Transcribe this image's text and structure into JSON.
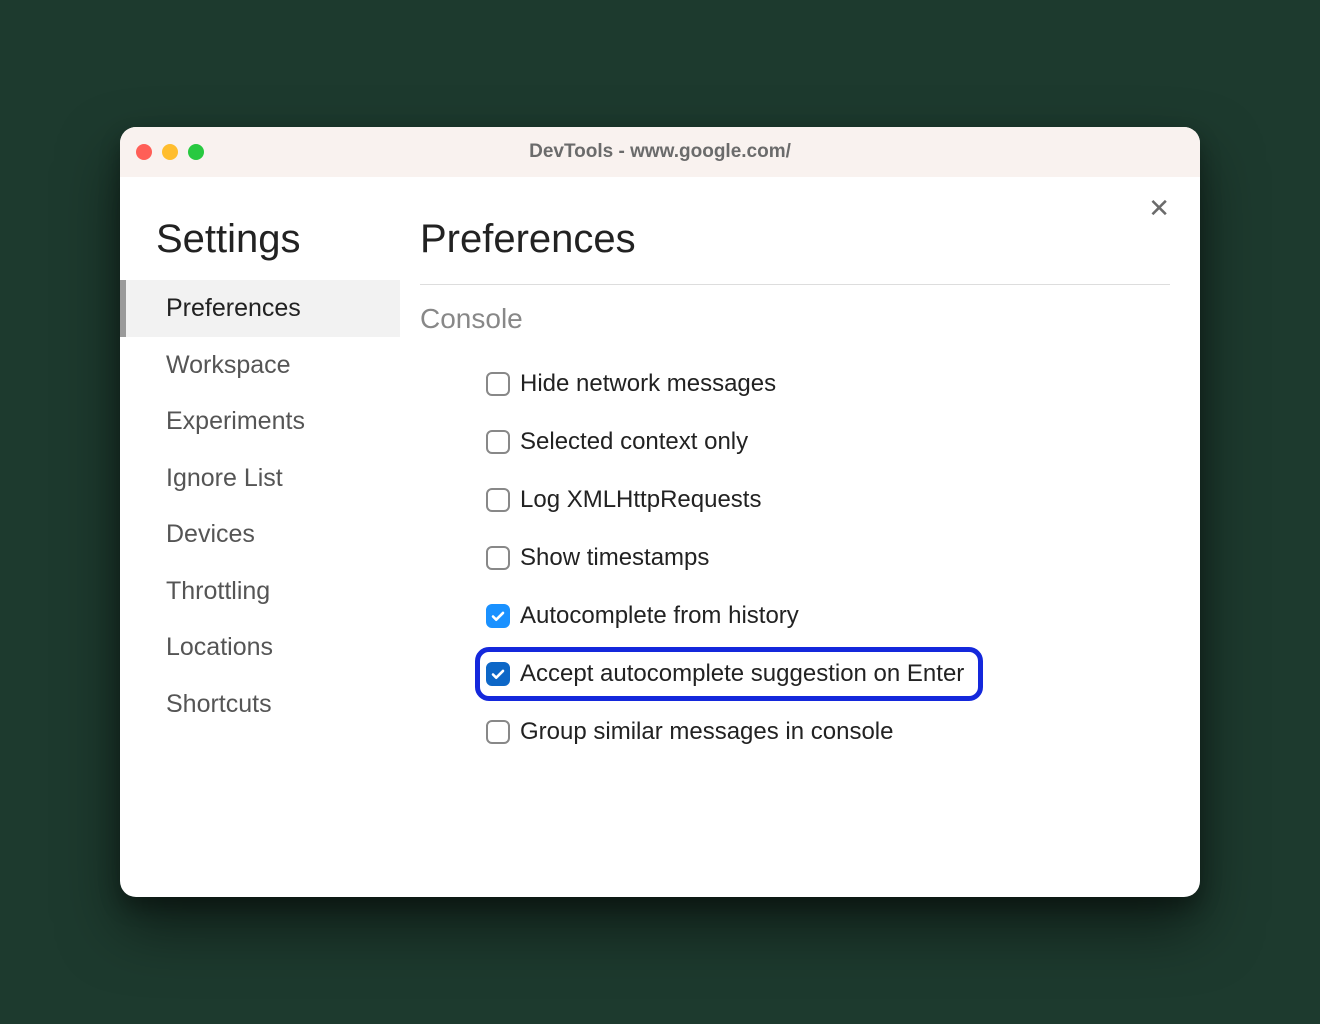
{
  "titlebar": {
    "title": "DevTools - www.google.com/"
  },
  "sidebar": {
    "heading": "Settings",
    "items": [
      {
        "label": "Preferences",
        "selected": true
      },
      {
        "label": "Workspace",
        "selected": false
      },
      {
        "label": "Experiments",
        "selected": false
      },
      {
        "label": "Ignore List",
        "selected": false
      },
      {
        "label": "Devices",
        "selected": false
      },
      {
        "label": "Throttling",
        "selected": false
      },
      {
        "label": "Locations",
        "selected": false
      },
      {
        "label": "Shortcuts",
        "selected": false
      }
    ]
  },
  "main": {
    "heading": "Preferences",
    "section": "Console",
    "options": [
      {
        "label": "Hide network messages",
        "checked": false,
        "highlighted": false
      },
      {
        "label": "Selected context only",
        "checked": false,
        "highlighted": false
      },
      {
        "label": "Log XMLHttpRequests",
        "checked": false,
        "highlighted": false
      },
      {
        "label": "Show timestamps",
        "checked": false,
        "highlighted": false
      },
      {
        "label": "Autocomplete from history",
        "checked": true,
        "highlighted": false
      },
      {
        "label": "Accept autocomplete suggestion on Enter",
        "checked": true,
        "highlighted": true
      },
      {
        "label": "Group similar messages in console",
        "checked": false,
        "highlighted": false
      }
    ]
  }
}
